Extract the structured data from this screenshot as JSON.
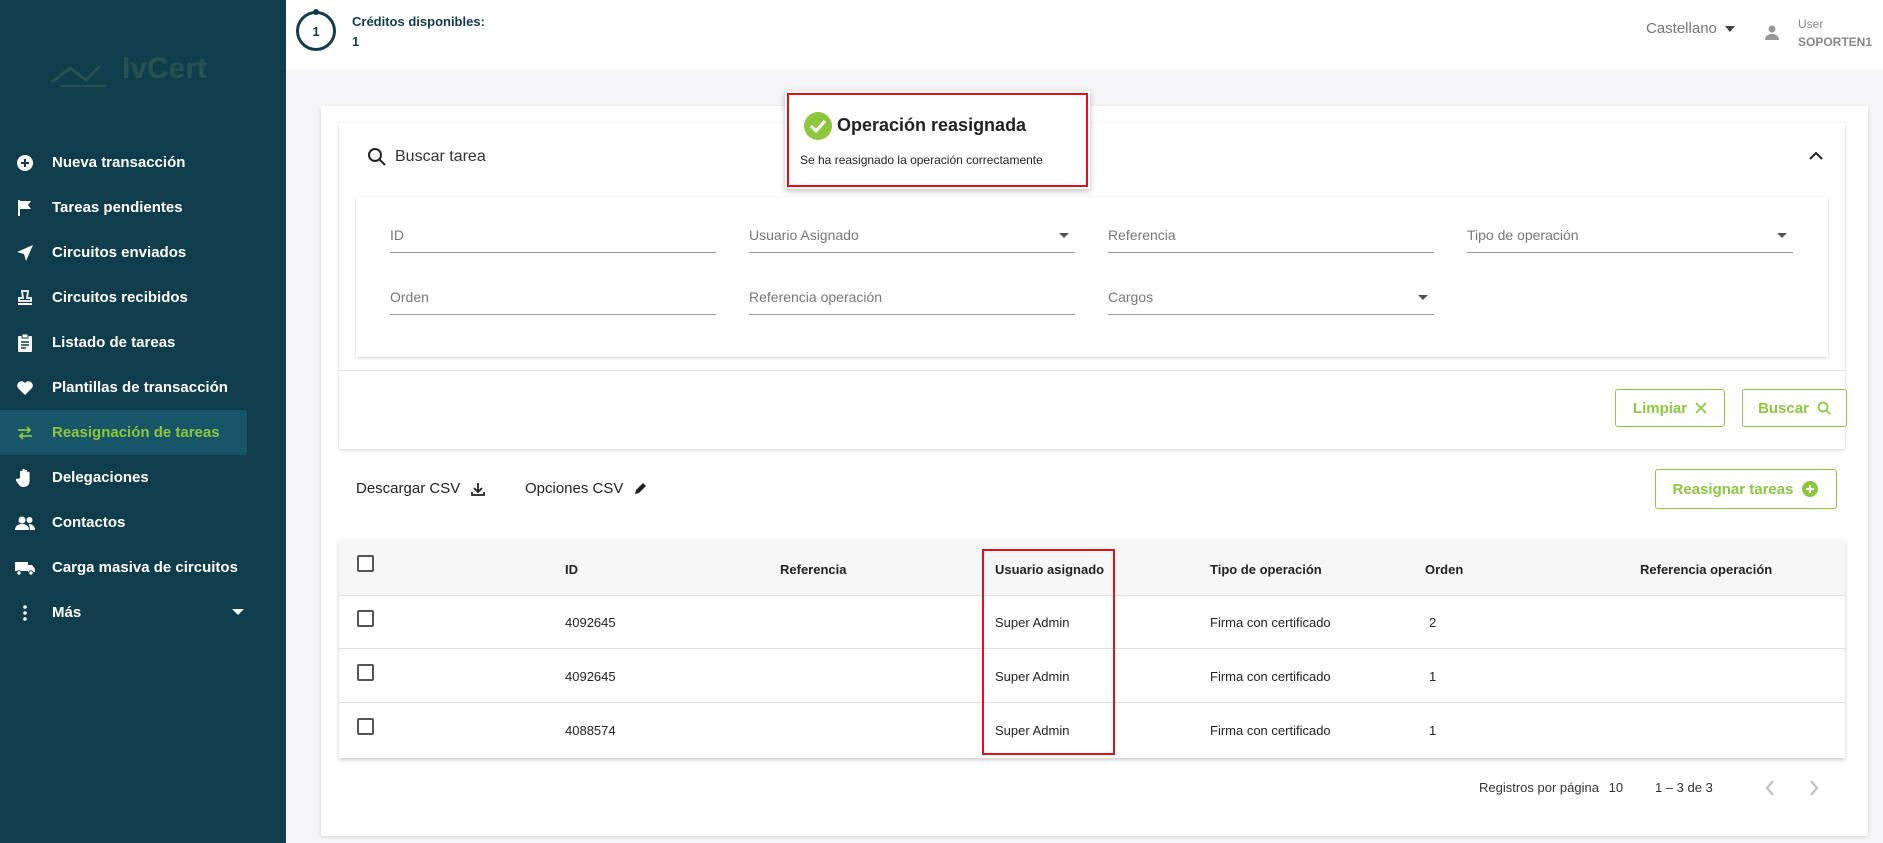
{
  "sidebar": {
    "logo_text": "IvCert",
    "items": [
      {
        "label": "Nueva transacción",
        "icon": "plus-circle-icon"
      },
      {
        "label": "Tareas pendientes",
        "icon": "flag-icon"
      },
      {
        "label": "Circuitos enviados",
        "icon": "send-icon"
      },
      {
        "label": "Circuitos recibidos",
        "icon": "stamp-icon"
      },
      {
        "label": "Listado de tareas",
        "icon": "clipboard-icon"
      },
      {
        "label": "Plantillas de transacción",
        "icon": "heart-icon"
      },
      {
        "label": "Reasignación de tareas",
        "icon": "swap-icon",
        "active": true
      },
      {
        "label": "Delegaciones",
        "icon": "hand-icon"
      },
      {
        "label": "Contactos",
        "icon": "people-icon"
      },
      {
        "label": "Carga masiva de circuitos",
        "icon": "truck-icon"
      },
      {
        "label": "Más",
        "icon": "more-vertical-icon"
      }
    ]
  },
  "header": {
    "credits_count": "1",
    "credits_label": "Créditos disponibles:",
    "credits_value": "1",
    "language": "Castellano",
    "user_label": "User",
    "user_name": "SOPORTEN1"
  },
  "search": {
    "title": "Buscar tarea",
    "fields": {
      "id": "ID",
      "usuario_asignado": "Usuario Asignado",
      "referencia": "Referencia",
      "tipo_operacion": "Tipo de operación",
      "orden": "Orden",
      "referencia_operacion": "Referencia operación",
      "cargos": "Cargos"
    },
    "clear_label": "Limpiar",
    "search_label": "Buscar"
  },
  "toolbar": {
    "download_csv": "Descargar CSV",
    "csv_options": "Opciones CSV",
    "reassign": "Reasignar tareas"
  },
  "table": {
    "columns": [
      "ID",
      "Referencia",
      "Usuario asignado",
      "Tipo de operación",
      "Orden",
      "Referencia operación"
    ],
    "rows": [
      {
        "id": "4092645",
        "referencia": "",
        "usuario": "Super Admin",
        "tipo": "Firma con certificado",
        "orden": "2",
        "ref_op": ""
      },
      {
        "id": "4092645",
        "referencia": "",
        "usuario": "Super Admin",
        "tipo": "Firma con certificado",
        "orden": "1",
        "ref_op": ""
      },
      {
        "id": "4088574",
        "referencia": "",
        "usuario": "Super Admin",
        "tipo": "Firma con certificado",
        "orden": "1",
        "ref_op": ""
      }
    ]
  },
  "pagination": {
    "per_page_label": "Registros por página",
    "per_page_value": "10",
    "range": "1 – 3 de 3"
  },
  "toast": {
    "title": "Operación reasignada",
    "message": "Se ha reasignado la operación correctamente"
  },
  "colors": {
    "sidebar_bg": "#0f3d4c",
    "accent_green": "#8dc63f",
    "highlight_red": "#e0101b"
  }
}
